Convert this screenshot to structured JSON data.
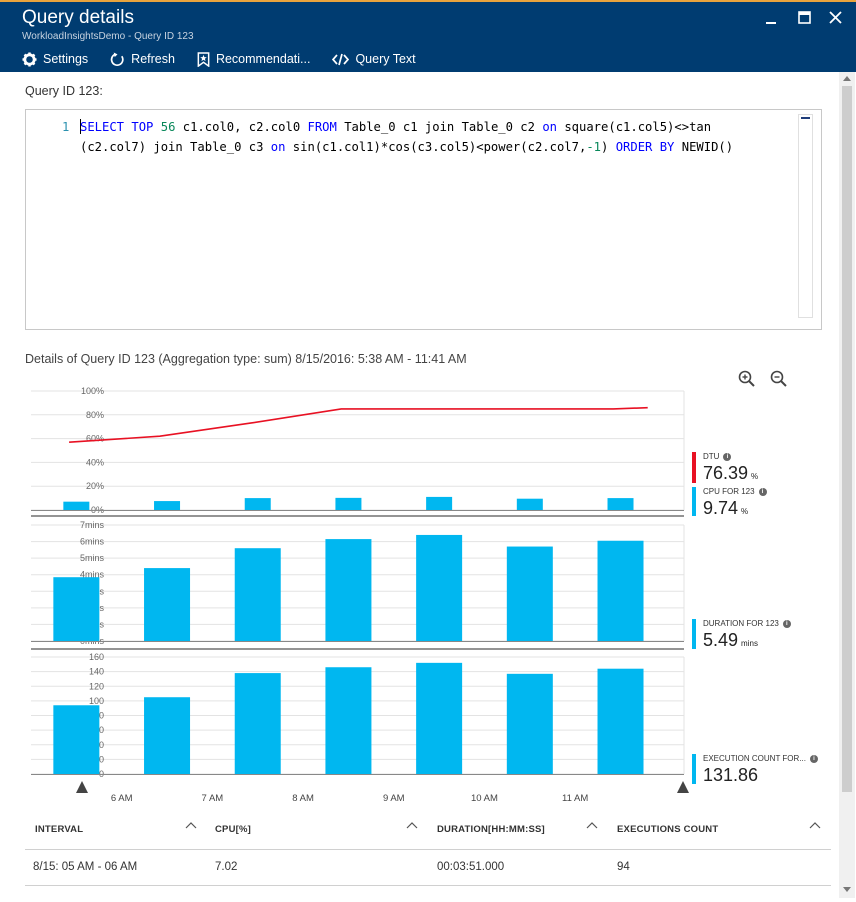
{
  "window": {
    "title": "Query details",
    "subtitle": "WorkloadInsightsDemo - Query ID 123"
  },
  "toolbar": {
    "settings_label": "Settings",
    "refresh_label": "Refresh",
    "recommendations_label": "Recommendati...",
    "query_text_label": "Query Text"
  },
  "query": {
    "label": "Query ID 123:",
    "line_number": "1",
    "code": {
      "t1": "SELECT",
      "t2": " ",
      "t3": "TOP",
      "t4": " ",
      "t5": "56",
      "t6": " c1.col0, c2.col0 ",
      "t7": "FROM",
      "t8": " Table_0 c1 join Table_0 c2 ",
      "t9": "on",
      "t10": " square(c1.col5)<>tan\n(c2.col7) join Table_0 c3 ",
      "t11": "on",
      "t12": " sin(c1.col1)*cos(c3.col5)<power(c2.col7,",
      "t13": "-1",
      "t14": ") ",
      "t15": "ORDER BY",
      "t16": " NEWID()"
    }
  },
  "details": {
    "label": "Details of Query ID 123 (Aggregation type: sum) 8/15/2016: 5:38 AM - 11:41 AM"
  },
  "legend": {
    "dtu": {
      "name": "DTU",
      "value": "76.39",
      "unit": "%",
      "color": "#e81123"
    },
    "cpu": {
      "name": "CPU FOR 123",
      "value": "9.74",
      "unit": "%",
      "color": "#00b7f0"
    },
    "duration": {
      "name": "DURATION FOR 123",
      "value": "5.49",
      "unit": "mins",
      "color": "#00b7f0"
    },
    "executions": {
      "name": "EXECUTION COUNT FOR...",
      "value": "131.86",
      "unit": "",
      "color": "#00b7f0"
    }
  },
  "chart_data": [
    {
      "type": "line",
      "name": "DTU / CPU",
      "ylim": [
        0,
        100
      ],
      "yticks": [
        "0%",
        "20%",
        "40%",
        "60%",
        "80%",
        "100%"
      ],
      "series": [
        {
          "name": "DTU",
          "color": "#e81123",
          "x": [
            5.42,
            6.42,
            7.42,
            8.42,
            9.42,
            10.42,
            11.42,
            11.8
          ],
          "values": [
            57,
            62,
            73,
            85,
            85,
            85,
            85,
            86
          ]
        },
        {
          "name": "CPU FOR 123",
          "color": "#00b7f0",
          "kind": "bar",
          "x": [
            5.5,
            6.5,
            7.5,
            8.5,
            9.5,
            10.5,
            11.5
          ],
          "values": [
            7.0,
            7.5,
            10.0,
            10.2,
            11.0,
            9.5,
            10.0
          ]
        }
      ]
    },
    {
      "type": "bar",
      "name": "DURATION FOR 123",
      "ylim": [
        0,
        7
      ],
      "yticks": [
        "0mins",
        "1mins",
        "2mins",
        "3mins",
        "4mins",
        "5mins",
        "6mins",
        "7mins"
      ],
      "categories": [
        "05 AM",
        "06 AM",
        "07 AM",
        "08 AM",
        "09 AM",
        "10 AM",
        "11 AM"
      ],
      "values": [
        3.85,
        4.4,
        5.6,
        6.15,
        6.4,
        5.7,
        6.05
      ]
    },
    {
      "type": "bar",
      "name": "EXECUTION COUNT FOR 123",
      "ylim": [
        0,
        160
      ],
      "yticks": [
        "0",
        "20",
        "40",
        "60",
        "80",
        "100",
        "120",
        "140",
        "160"
      ],
      "categories": [
        "05 AM",
        "06 AM",
        "07 AM",
        "08 AM",
        "09 AM",
        "10 AM",
        "11 AM"
      ],
      "values": [
        94,
        105,
        138,
        146,
        152,
        137,
        144
      ]
    }
  ],
  "x_axis": {
    "labels": [
      "6 AM",
      "7 AM",
      "8 AM",
      "9 AM",
      "10 AM",
      "11 AM"
    ]
  },
  "table": {
    "headers": [
      "INTERVAL",
      "CPU[%]",
      "DURATION[HH:MM:SS]",
      "EXECUTIONS COUNT"
    ],
    "rows": [
      [
        "8/15: 05 AM - 06 AM",
        "7.02",
        "00:03:51.000",
        "94"
      ]
    ]
  }
}
